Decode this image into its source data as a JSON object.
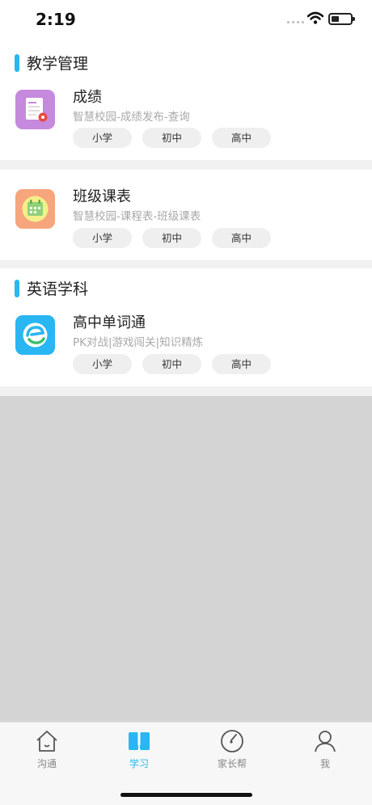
{
  "status": {
    "time": "2:19"
  },
  "sections": [
    {
      "title": "教学管理",
      "apps": [
        {
          "title": "成绩",
          "subtitle": "智慧校园-成绩发布-查询",
          "icon": "report-card-icon",
          "tags": [
            "小学",
            "初中",
            "高中"
          ]
        },
        {
          "title": "班级课表",
          "subtitle": "智慧校园-课程表-班级课表",
          "icon": "calendar-icon",
          "tags": [
            "小学",
            "初中",
            "高中"
          ]
        }
      ]
    },
    {
      "title": "英语学科",
      "apps": [
        {
          "title": "高中单词通",
          "subtitle": "PK对战|游戏闯关|知识精炼",
          "icon": "word-app-logo-icon",
          "tags": [
            "小学",
            "初中",
            "高中"
          ]
        }
      ]
    }
  ],
  "tabbar": {
    "items": [
      {
        "label": "沟通",
        "icon": "house-icon",
        "active": false
      },
      {
        "label": "学习",
        "icon": "book-icon",
        "active": true
      },
      {
        "label": "家长帮",
        "icon": "compass-icon",
        "active": false
      },
      {
        "label": "我",
        "icon": "person-icon",
        "active": false
      }
    ]
  },
  "colors": {
    "accent": "#29b6f2",
    "inactive": "#888888",
    "background": "#d4d4d4"
  }
}
